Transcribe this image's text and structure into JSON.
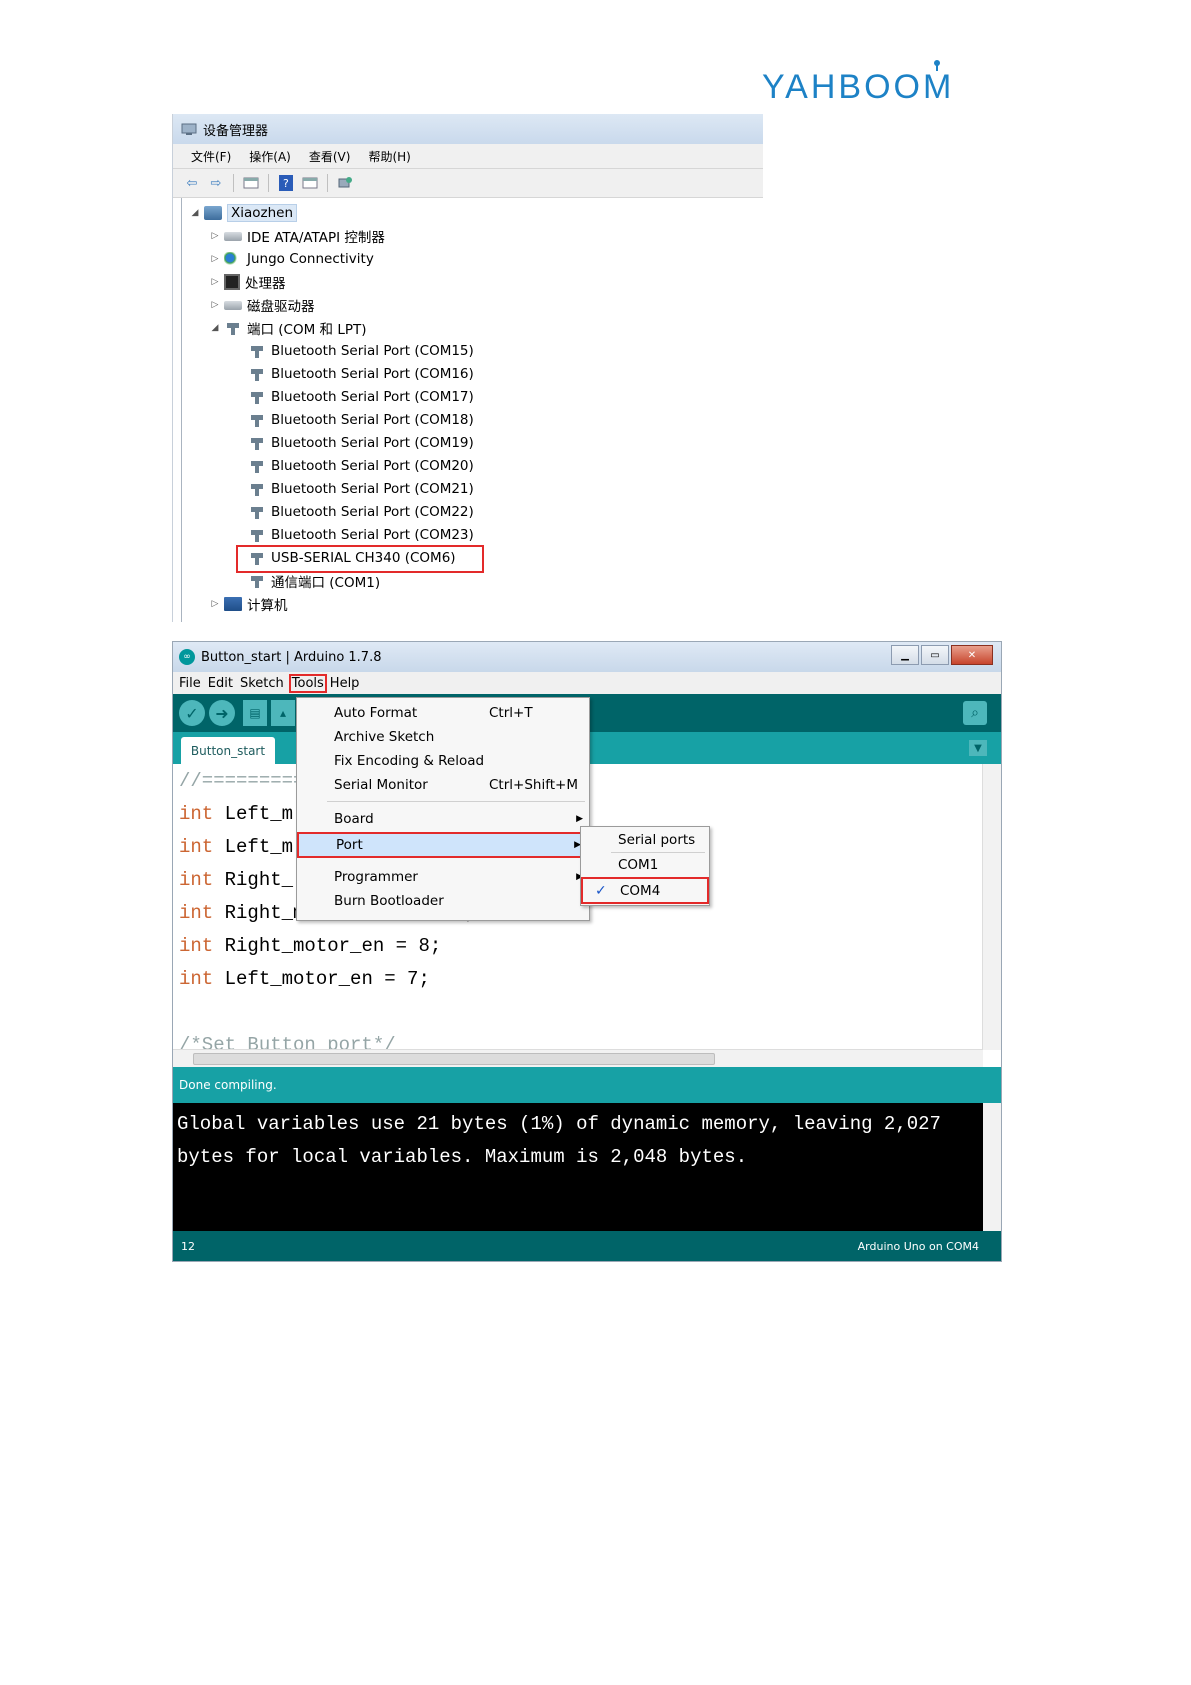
{
  "logo": {
    "text": "YAHBOOM"
  },
  "device_manager": {
    "title": "设备管理器",
    "menu": [
      "文件(F)",
      "操作(A)",
      "查看(V)",
      "帮助(H)"
    ],
    "tree": {
      "root": "Xiaozhen",
      "categories": [
        {
          "label": "IDE ATA/ATAPI 控制器",
          "icon": "ide-controller-icon",
          "expanded": false
        },
        {
          "label": "Jungo Connectivity",
          "icon": "jungo-icon",
          "expanded": false
        },
        {
          "label": "处理器",
          "icon": "processor-icon",
          "expanded": false
        },
        {
          "label": "磁盘驱动器",
          "icon": "disk-drive-icon",
          "expanded": false
        },
        {
          "label": "端口 (COM 和 LPT)",
          "icon": "port-icon",
          "expanded": true
        }
      ],
      "ports": [
        "Bluetooth Serial Port (COM15)",
        "Bluetooth Serial Port (COM16)",
        "Bluetooth Serial Port (COM17)",
        "Bluetooth Serial Port (COM18)",
        "Bluetooth Serial Port (COM19)",
        "Bluetooth Serial Port (COM20)",
        "Bluetooth Serial Port (COM21)",
        "Bluetooth Serial Port (COM22)",
        "Bluetooth Serial Port (COM23)",
        "USB-SERIAL CH340 (COM6)",
        "通信端口 (COM1)"
      ],
      "highlighted_port": "USB-SERIAL CH340 (COM6)",
      "last_category": "计算机"
    }
  },
  "arduino": {
    "window_title": "Button_start | Arduino 1.7.8",
    "menubar": [
      "File",
      "Edit",
      "Sketch",
      "Tools",
      "Help"
    ],
    "tab": "Button_start",
    "code": [
      {
        "kw": "",
        "text": "//=========="
      },
      {
        "kw": "int",
        "text": " Left_m"
      },
      {
        "kw": "int",
        "text": " Left_m"
      },
      {
        "kw": "int",
        "text": " Right_"
      },
      {
        "kw": "int",
        "text": " Right_motor_back = 10;"
      },
      {
        "kw": "int",
        "text": " Right_motor_en = 8;"
      },
      {
        "kw": "int",
        "text": " Left_motor_en = 7;"
      },
      {
        "kw": "",
        "text": ""
      },
      {
        "kw": "",
        "text": "/*Set Button port*/"
      }
    ],
    "status": "Done compiling.",
    "console": [
      "Global variables use 21 bytes (1%) of dynamic memory, leaving 2,027",
      "bytes for local variables. Maximum is 2,048 bytes."
    ],
    "footer_left": "12",
    "footer_right": "Arduino Uno on COM4",
    "tools_menu": {
      "items": [
        {
          "label": "Auto Format",
          "shortcut": "Ctrl+T"
        },
        {
          "label": "Archive Sketch",
          "shortcut": ""
        },
        {
          "label": "Fix Encoding & Reload",
          "shortcut": ""
        },
        {
          "label": "Serial Monitor",
          "shortcut": "Ctrl+Shift+M"
        },
        {
          "label": "Board",
          "shortcut": "",
          "submenu": true
        },
        {
          "label": "Port",
          "shortcut": "",
          "submenu": true,
          "active": true
        },
        {
          "label": "Programmer",
          "shortcut": "",
          "submenu": true
        },
        {
          "label": "Burn Bootloader",
          "shortcut": ""
        }
      ]
    },
    "port_submenu": {
      "header": "Serial ports",
      "items": [
        {
          "label": "COM1",
          "checked": false
        },
        {
          "label": "COM4",
          "checked": true
        }
      ]
    }
  },
  "colors": {
    "highlight_box": "#e32a2a",
    "arduino_teal_dark": "#006468",
    "arduino_teal": "#17a1a5",
    "logo_blue": "#1d82c6"
  }
}
